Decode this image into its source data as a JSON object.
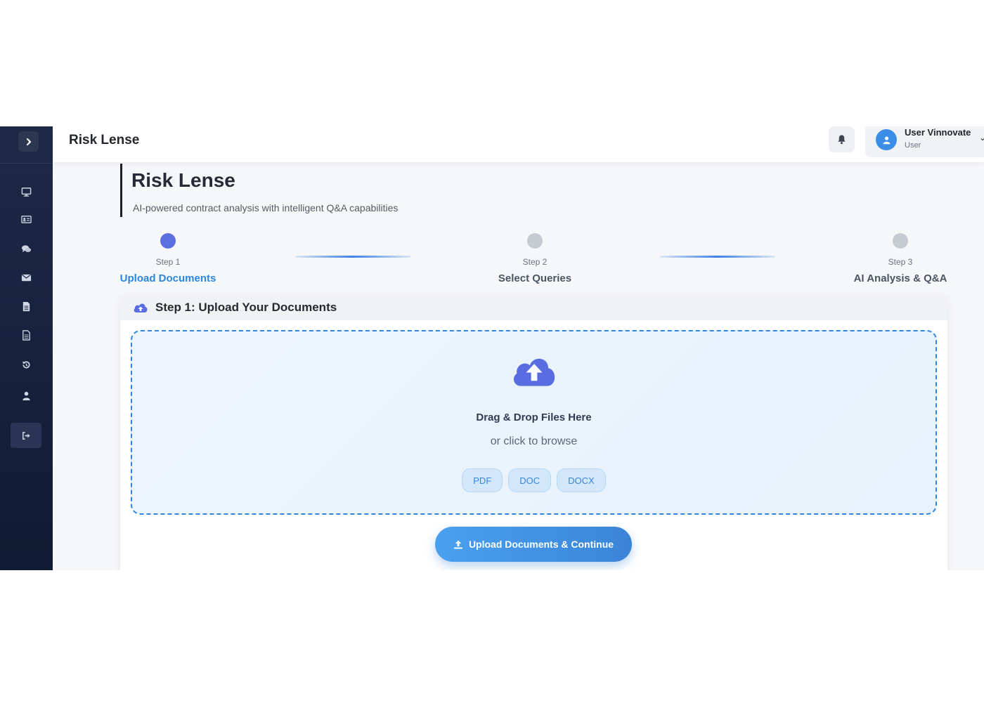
{
  "topbar": {
    "title": "Risk Lense"
  },
  "user": {
    "name": "User Vinnovate",
    "role": "User"
  },
  "sidebar": {
    "items": [
      {
        "icon": "monitor-icon"
      },
      {
        "icon": "id-card-icon"
      },
      {
        "icon": "comments-icon"
      },
      {
        "icon": "envelope-icon"
      },
      {
        "icon": "file-icon"
      },
      {
        "icon": "file-text-icon"
      },
      {
        "icon": "history-icon"
      },
      {
        "icon": "user-icon"
      },
      {
        "icon": "sign-out-icon"
      }
    ]
  },
  "header": {
    "title": "Risk Lense",
    "subtitle": "AI-powered contract analysis with intelligent Q&A capabilities"
  },
  "steps": [
    {
      "number": "Step 1",
      "label": "Upload Documents",
      "active": true
    },
    {
      "number": "Step 2",
      "label": "Select Queries",
      "active": false
    },
    {
      "number": "Step 3",
      "label": "AI Analysis & Q&A",
      "active": false
    }
  ],
  "card": {
    "title": "Step 1: Upload Your Documents",
    "dropzone_title": "Drag & Drop Files Here",
    "dropzone_sub": "or click to browse",
    "formats": [
      "PDF",
      "DOC",
      "DOCX"
    ],
    "upload_button": "Upload Documents & Continue"
  },
  "colors": {
    "accent": "#2a86e0",
    "step_active": "#5b6fe0",
    "step_inactive": "#c6cad1",
    "sidebar_bg": "#17223d"
  }
}
